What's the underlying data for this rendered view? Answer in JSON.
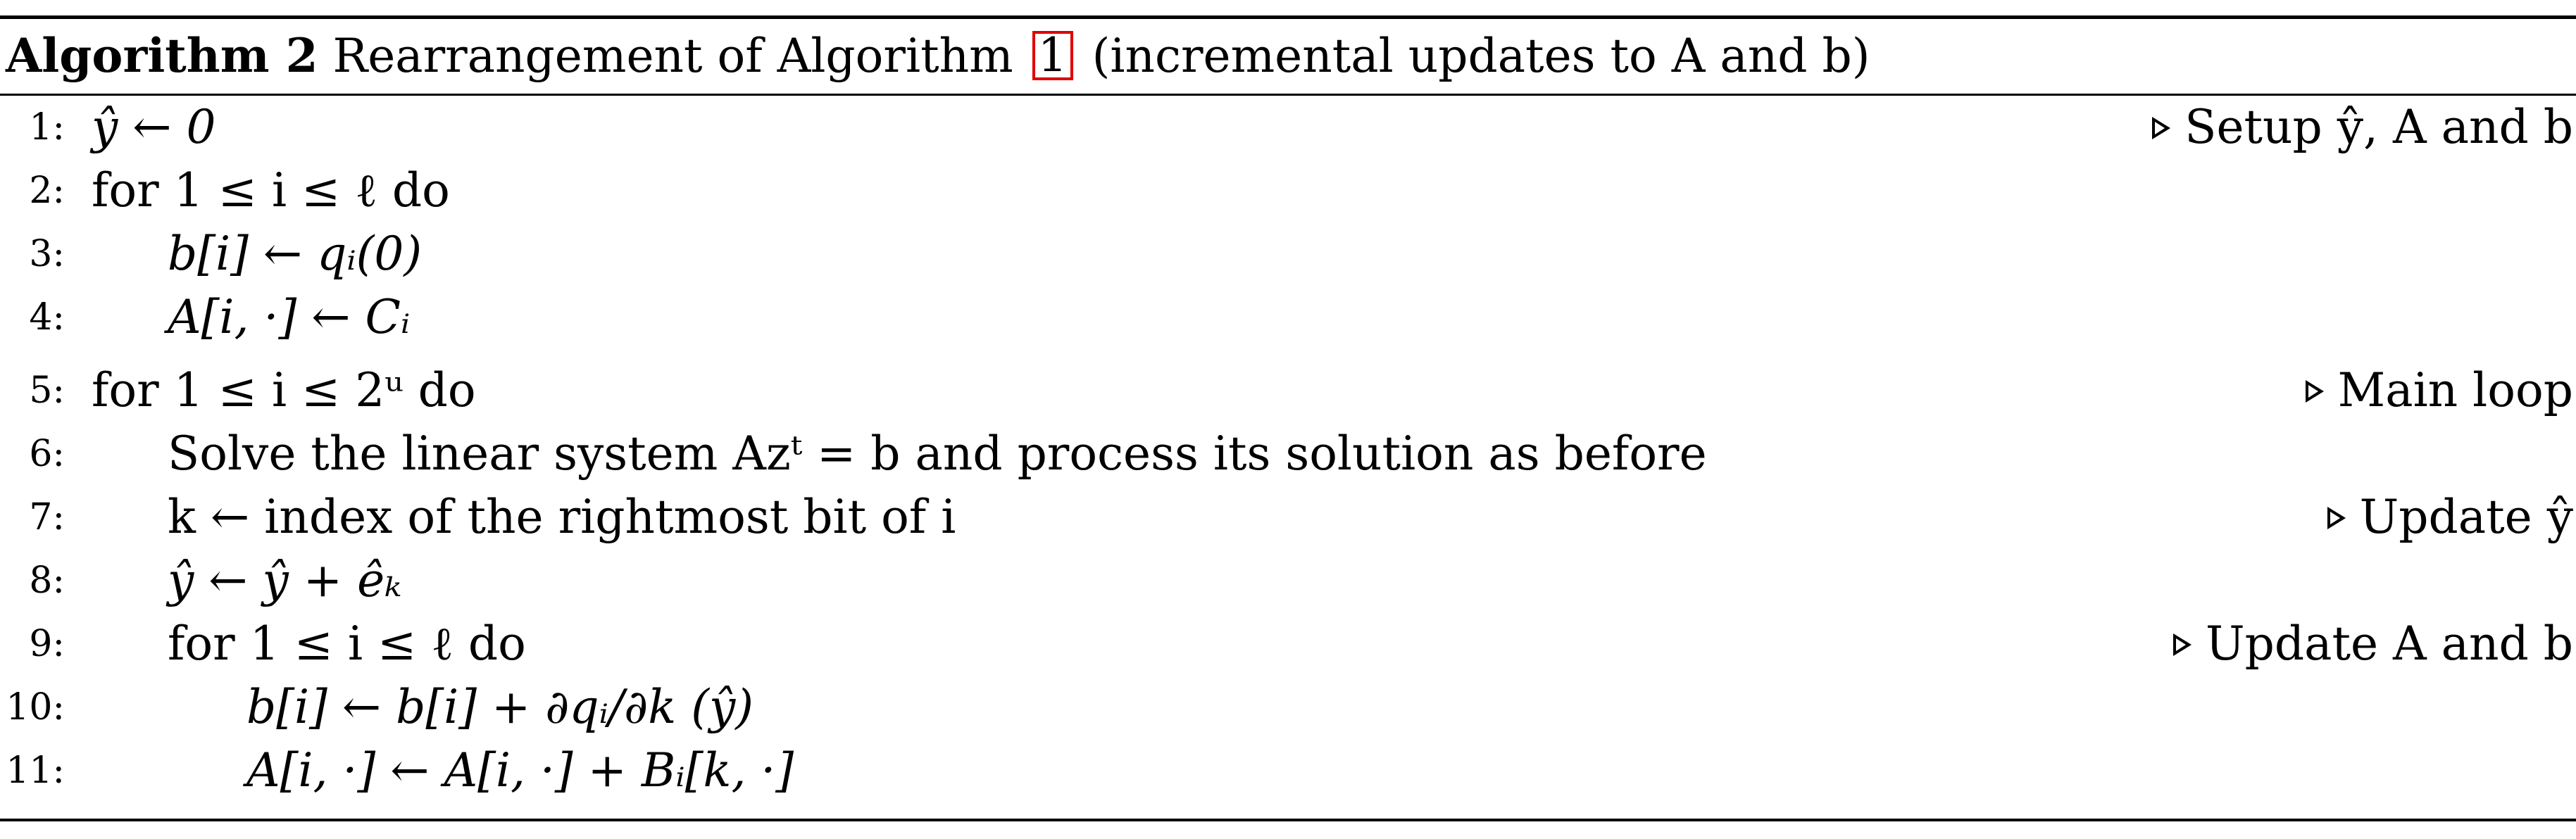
{
  "algorithm": {
    "label": "Algorithm 2",
    "title_before_ref": "Rearrangement of Algorithm",
    "ref": "1",
    "title_after_ref": "(incremental updates to A and b)"
  },
  "lines": [
    {
      "num": "1:",
      "code": "ŷ ← 0",
      "comment": "Setup ŷ, A and b"
    },
    {
      "num": "2:",
      "code": "for 1 ≤ i ≤ ℓ do",
      "comment": ""
    },
    {
      "num": "3:",
      "code": "b[i] ← qᵢ(0)",
      "comment": ""
    },
    {
      "num": "4:",
      "code": "A[i, ·] ← Cᵢ",
      "comment": ""
    },
    {
      "num": "5:",
      "code": "for 1 ≤ i ≤ 2ᵘ do",
      "comment": "Main loop"
    },
    {
      "num": "6:",
      "code": "Solve the linear system Azᵗ = b and process its solution as before",
      "comment": ""
    },
    {
      "num": "7:",
      "code": "k ← index of the rightmost bit of i",
      "comment": "Update ŷ"
    },
    {
      "num": "8:",
      "code": "ŷ ← ŷ + êₖ",
      "comment": ""
    },
    {
      "num": "9:",
      "code": "for 1 ≤ i ≤ ℓ do",
      "comment": "Update A and b"
    },
    {
      "num": "10:",
      "code": "b[i] ← b[i] + ∂qᵢ/∂k (ŷ)",
      "comment": ""
    },
    {
      "num": "11:",
      "code": "A[i, ·] ← A[i, ·] + Bᵢ[k, ·]",
      "comment": ""
    }
  ]
}
